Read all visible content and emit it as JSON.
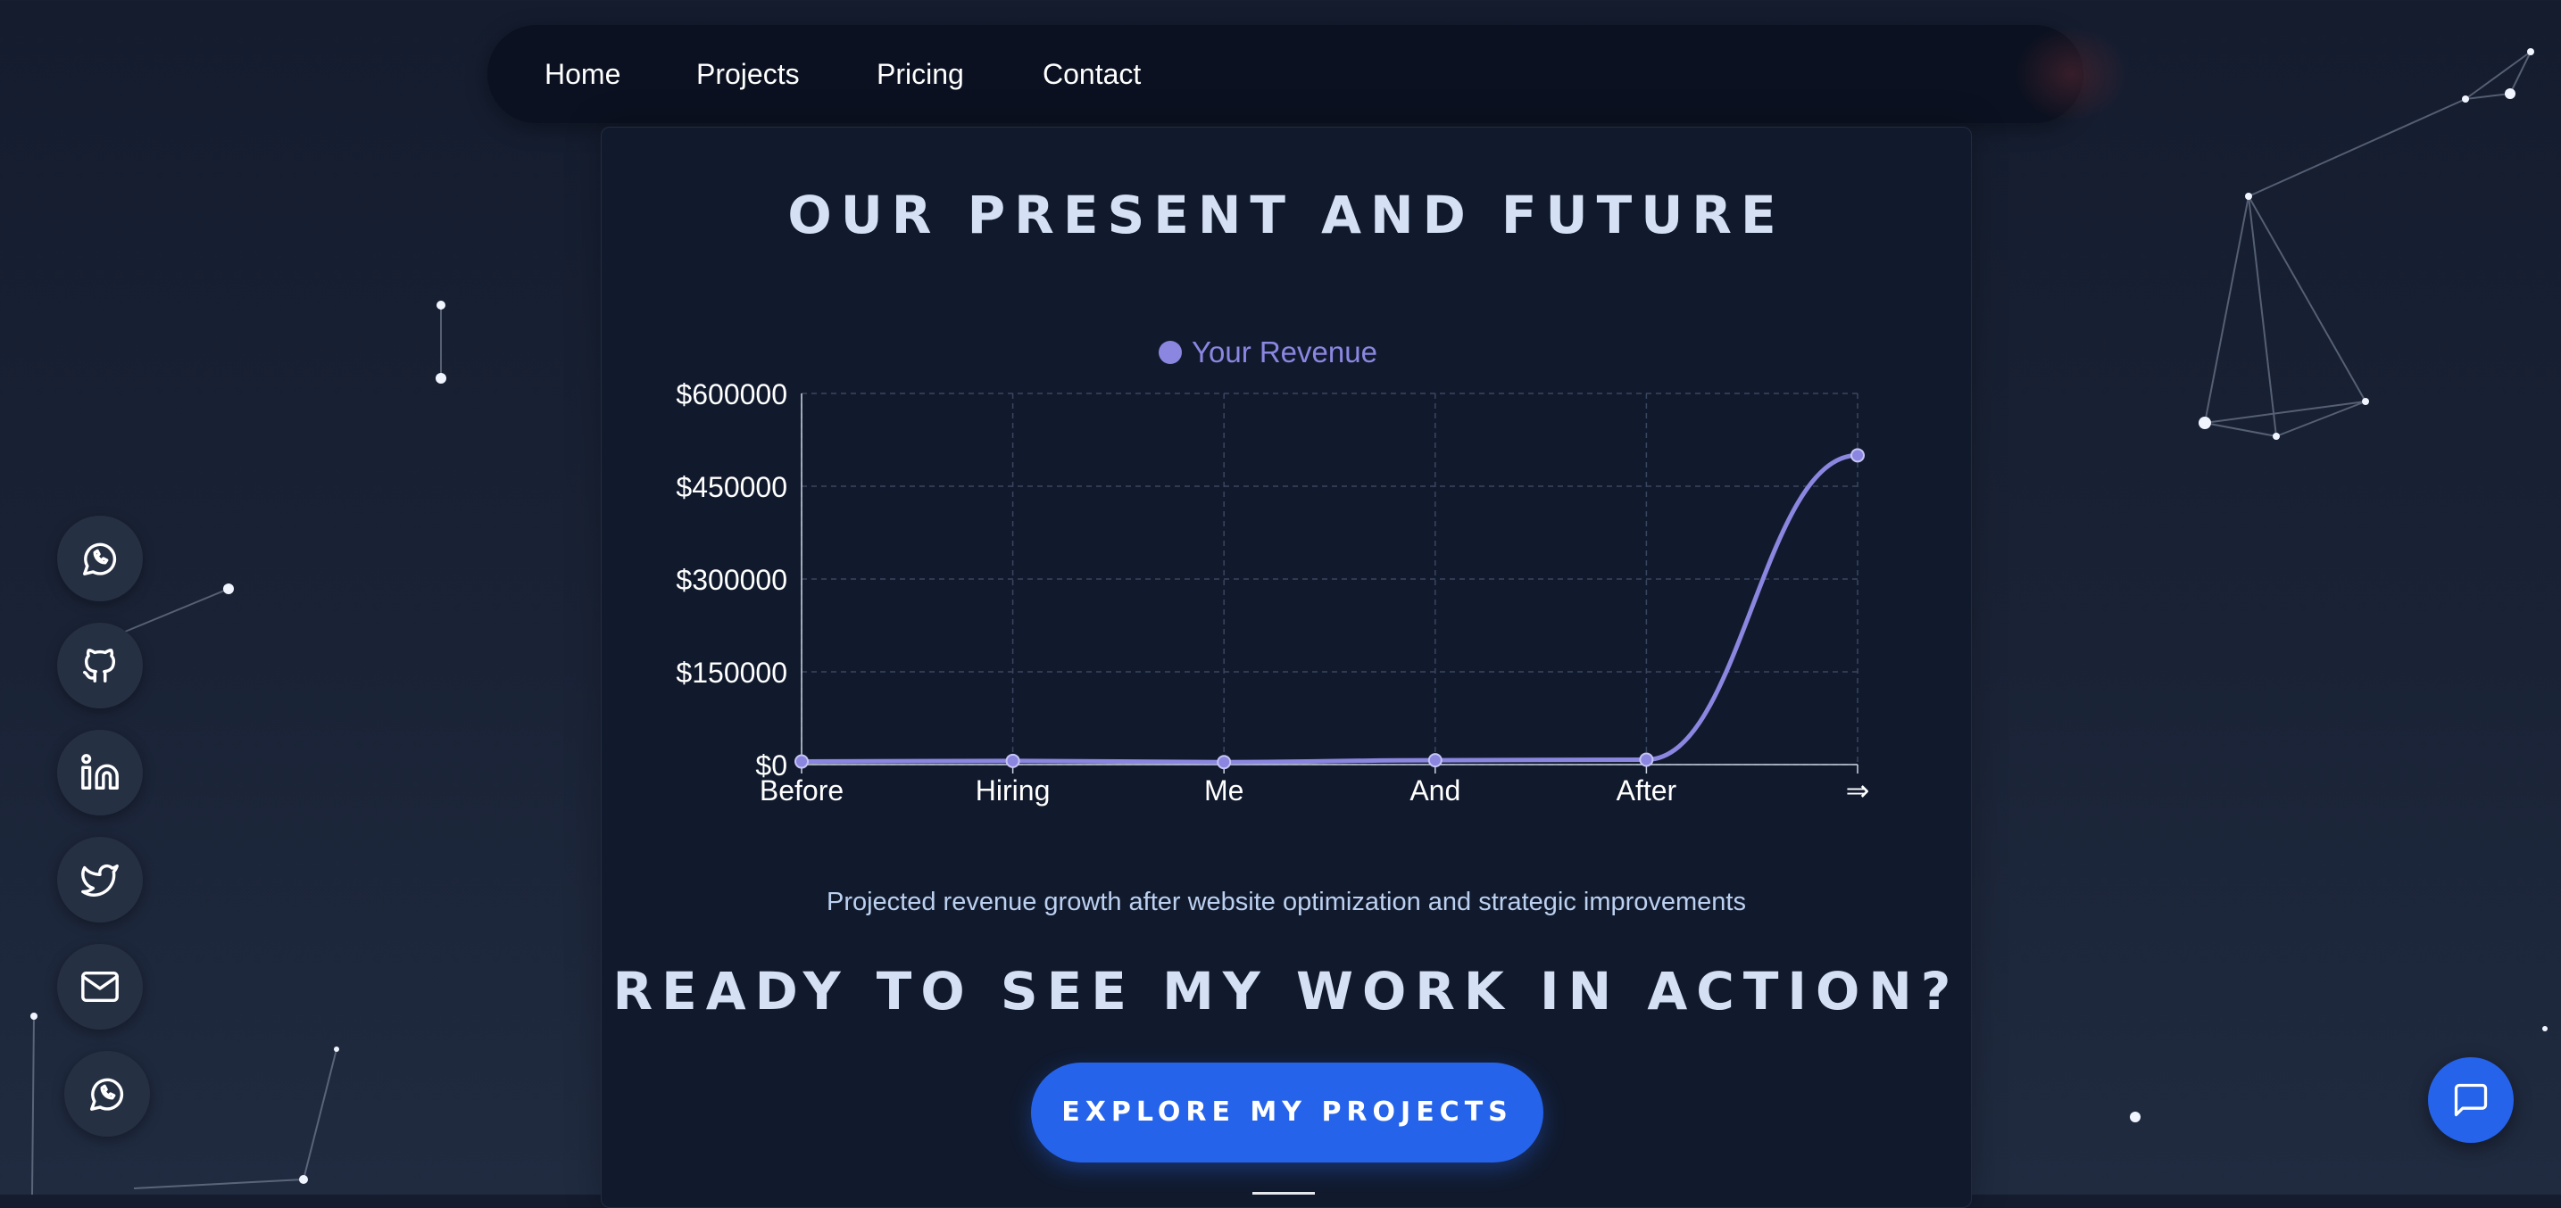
{
  "nav": {
    "items": [
      {
        "label": "Home"
      },
      {
        "label": "Projects"
      },
      {
        "label": "Pricing"
      },
      {
        "label": "Contact"
      }
    ]
  },
  "section": {
    "title": "OUR PRESENT AND FUTURE",
    "caption": "Projected revenue growth after website optimization and strategic improvements"
  },
  "cta_section": {
    "title": "READY TO SEE MY WORK IN ACTION?",
    "button_label": "EXPLORE MY PROJECTS"
  },
  "social": [
    {
      "icon": "whatsapp-icon"
    },
    {
      "icon": "github-icon"
    },
    {
      "icon": "linkedin-icon"
    },
    {
      "icon": "twitter-icon"
    },
    {
      "icon": "mail-icon"
    },
    {
      "icon": "whatsapp-icon"
    }
  ],
  "chat": {
    "icon": "chat-bubble-icon"
  },
  "colors": {
    "accent": "#2563eb",
    "series": "#8b86e0",
    "background": "#141c2e"
  },
  "chart_data": {
    "type": "line",
    "categories": [
      "Before",
      "Hiring",
      "Me",
      "And",
      "After",
      "⇒"
    ],
    "series": [
      {
        "name": "Your Revenue",
        "values": [
          5000,
          6000,
          4000,
          7000,
          8000,
          500000
        ]
      }
    ],
    "ylim": [
      0,
      600000
    ],
    "yticks": [
      0,
      150000,
      300000,
      450000,
      600000
    ],
    "ytick_labels": [
      "$0",
      "$150000",
      "$300000",
      "$450000",
      "$600000"
    ],
    "grid": true,
    "legend": "top"
  }
}
